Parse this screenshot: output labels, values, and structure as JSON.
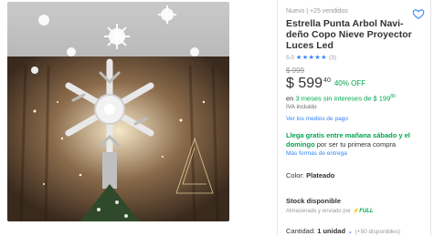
{
  "header": {
    "condition": "Nuevo",
    "separator": "|",
    "sold": "+25 vendidos"
  },
  "title": "Estrella Punta Arbol Navi-deño Copo Nieve Proyector Luces Led",
  "rating": {
    "score": "5.0",
    "stars": "★★★★★",
    "count": "(3)"
  },
  "price": {
    "old": "$ 999",
    "current": "$ 599",
    "cents": "40",
    "discount": "40% OFF"
  },
  "installments": {
    "prefix": "en",
    "highlight": "3 meses sin intereses de $ 199",
    "cents": "80"
  },
  "tax_note": "IVA incluido",
  "payment_link": "Ver los medios de pago",
  "shipping": {
    "highlight": "Llega gratis entre mañana sábado y el domingo",
    "rest": "por ser tu primera compra",
    "more_link": "Más formas de entrega"
  },
  "color": {
    "label": "Color:",
    "value": "Plateado"
  },
  "stock": {
    "title": "Stock disponible",
    "store": "Almacenado y enviado por",
    "badge": "FULL"
  },
  "quantity": {
    "label": "Cantidad:",
    "value": "1 unidad",
    "available": "(+50 disponibles)"
  },
  "colors": {
    "accent": "#3483fa",
    "green": "#00a650"
  }
}
